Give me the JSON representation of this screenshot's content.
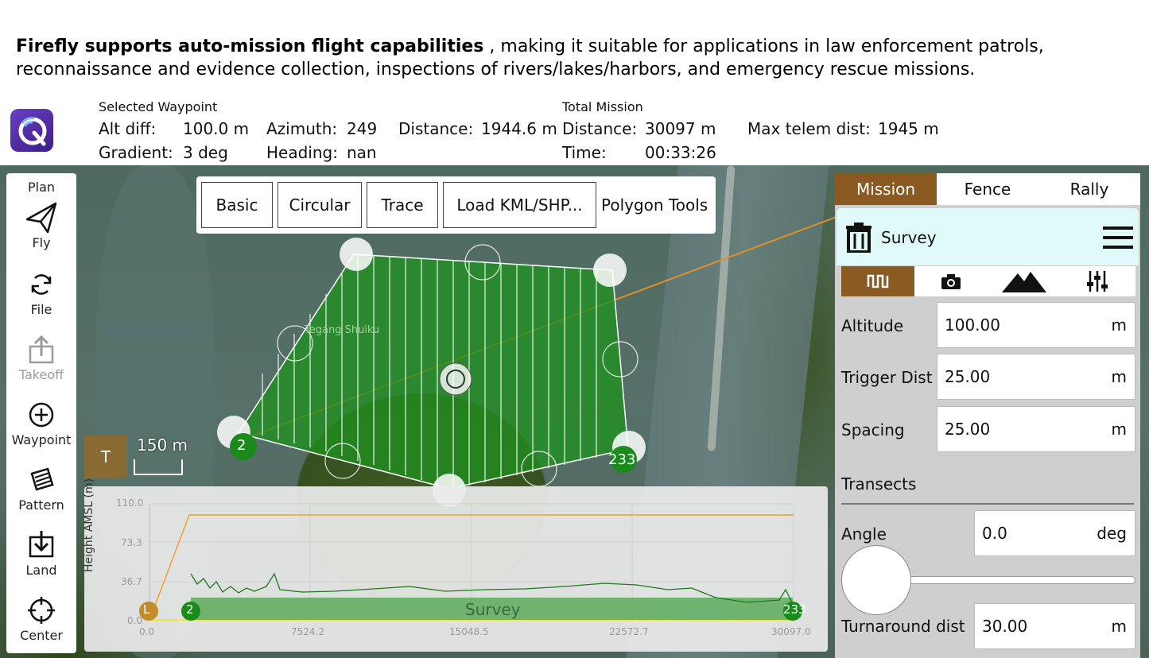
{
  "headline": {
    "bold": "Firefly supports auto-mission flight capabilities",
    "rest": " , making it suitable for applications in law enforcement patrols,",
    "line2": "reconnaissance and evidence collection, inspections of rivers/lakes/harbors, and emergency rescue missions."
  },
  "status": {
    "selected_title": "Selected Waypoint",
    "alt_diff_label": "Alt diff:",
    "alt_diff_value": "100.0 m",
    "azimuth_label": "Azimuth:",
    "azimuth_value": "249",
    "distance_label": "Distance:",
    "distance_value": "1944.6 m",
    "gradient_label": "Gradient:",
    "gradient_value": "3 deg",
    "heading_label": "Heading:",
    "heading_value": "nan",
    "total_title": "Total Mission",
    "total_distance_label": "Distance:",
    "total_distance_value": "30097 m",
    "time_label": "Time:",
    "time_value": "00:33:26",
    "max_telem_label": "Max telem dist:",
    "max_telem_value": "1945 m"
  },
  "toolbar": {
    "plan": "Plan",
    "fly": "Fly",
    "file": "File",
    "takeoff": "Takeoff",
    "waypoint": "Waypoint",
    "pattern": "Pattern",
    "land": "Land",
    "center": "Center"
  },
  "pattern_tools": {
    "basic": "Basic",
    "circular": "Circular",
    "trace": "Trace",
    "load_kml": "Load KML/SHP...",
    "polygon_tools": "Polygon Tools"
  },
  "map": {
    "map_label": "Tegang Shuiku",
    "scale_box": "T",
    "scale_label": "150 m",
    "wp_start": "2",
    "wp_end": "233",
    "launch_label": "Launch"
  },
  "elevation": {
    "y_label": "Height AMSL (m)",
    "y_ticks": [
      "110.0",
      "73.3",
      "36.7",
      "0.0"
    ],
    "x_ticks": [
      "0.0",
      "7524.2",
      "15048.5",
      "22572.7",
      "30097.0"
    ],
    "marker_launch": "L",
    "marker_start": "2",
    "marker_end": "233",
    "bar_label": "Survey"
  },
  "right_panel": {
    "tab_mission": "Mission",
    "tab_fence": "Fence",
    "tab_rally": "Rally",
    "survey_title": "Survey",
    "altitude_label": "Altitude",
    "altitude_value": "100.00",
    "altitude_unit": "m",
    "trigger_label": "Trigger Dist",
    "trigger_value": "25.00",
    "trigger_unit": "m",
    "spacing_label": "Spacing",
    "spacing_value": "25.00",
    "spacing_unit": "m",
    "transects_label": "Transects",
    "angle_label": "Angle",
    "angle_value": "0.0",
    "angle_unit": "deg",
    "turnaround_label": "Turnaround dist",
    "turnaround_value": "30.00",
    "turnaround_unit": "m"
  },
  "colors": {
    "accent_brown": "#8a5a22",
    "survey_green": "#1f8f1f",
    "flight_line": "#e0902a",
    "panel_header": "#e0fafa"
  }
}
